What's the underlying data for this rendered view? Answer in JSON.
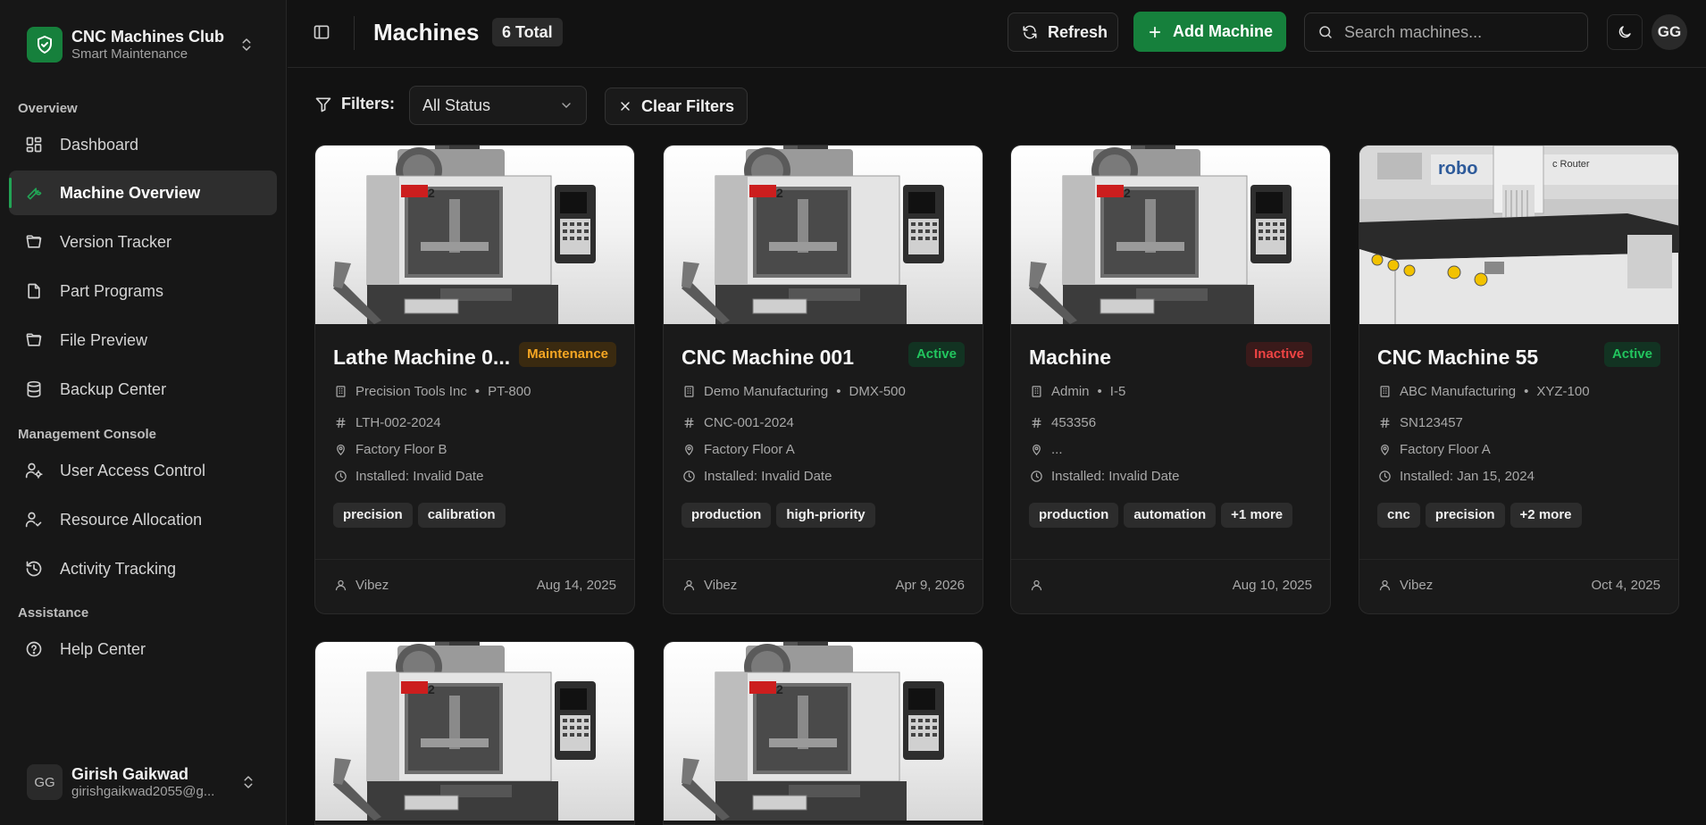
{
  "brand": {
    "title": "CNC Machines Club",
    "subtitle": "Smart Maintenance"
  },
  "sidebar": {
    "sections": {
      "overview": "Overview",
      "management": "Management Console",
      "assistance": "Assistance"
    },
    "items": [
      {
        "label": "Dashboard",
        "icon": "dashboard-icon"
      },
      {
        "label": "Machine Overview",
        "icon": "wrench-icon",
        "active": true
      },
      {
        "label": "Version Tracker",
        "icon": "folder-open-icon"
      },
      {
        "label": "Part Programs",
        "icon": "file-icon"
      },
      {
        "label": "File Preview",
        "icon": "folder-open-icon"
      },
      {
        "label": "Backup Center",
        "icon": "database-icon"
      },
      {
        "label": "User Access Control",
        "icon": "user-cog-icon"
      },
      {
        "label": "Resource Allocation",
        "icon": "user-check-icon"
      },
      {
        "label": "Activity Tracking",
        "icon": "history-icon"
      },
      {
        "label": "Help Center",
        "icon": "help-circle-icon"
      }
    ]
  },
  "user": {
    "initials": "GG",
    "name": "Girish Gaikwad",
    "email": "girishgaikwad2055@g..."
  },
  "header": {
    "title": "Machines",
    "total": "6 Total",
    "refresh_label": "Refresh",
    "add_label": "Add Machine",
    "search_placeholder": "Search machines...",
    "avatar_initials": "GG"
  },
  "filters": {
    "label": "Filters:",
    "status_value": "All Status",
    "clear_label": "Clear Filters"
  },
  "colors": {
    "accent_green": "#16803c",
    "status_active": "#22c55e",
    "status_inactive": "#ef4444",
    "status_maintenance": "#f5a623"
  },
  "machines": [
    {
      "title": "Lathe Machine 0...",
      "status": "Maintenance",
      "status_kind": "maint",
      "manufacturer": "Precision Tools Inc",
      "model": "PT-800",
      "serial": "LTH-002-2024",
      "location": "Factory Floor B",
      "installed": "Installed: Invalid Date",
      "tags": [
        "precision",
        "calibration"
      ],
      "owner": "Vibez",
      "date": "Aug 14, 2025",
      "image": "mill"
    },
    {
      "title": "CNC Machine 001",
      "status": "Active",
      "status_kind": "active",
      "manufacturer": "Demo Manufacturing",
      "model": "DMX-500",
      "serial": "CNC-001-2024",
      "location": "Factory Floor A",
      "installed": "Installed: Invalid Date",
      "tags": [
        "production",
        "high-priority"
      ],
      "owner": "Vibez",
      "date": "Apr 9, 2026",
      "image": "mill"
    },
    {
      "title": "Machine",
      "status": "Inactive",
      "status_kind": "inactive",
      "manufacturer": "Admin",
      "model": "I-5",
      "serial": "453356",
      "location": "...",
      "installed": "Installed: Invalid Date",
      "tags": [
        "production",
        "automation",
        "+1 more"
      ],
      "owner": "",
      "date": "Aug 10, 2025",
      "image": "mill"
    },
    {
      "title": "CNC Machine 55",
      "status": "Active",
      "status_kind": "active",
      "manufacturer": "ABC Manufacturing",
      "model": "XYZ-100",
      "serial": "SN123457",
      "location": "Factory Floor A",
      "installed": "Installed: Jan 15, 2024",
      "tags": [
        "cnc",
        "precision",
        "+2 more"
      ],
      "owner": "Vibez",
      "date": "Oct 4, 2025",
      "image": "router"
    }
  ],
  "router_image": {
    "brand_text": "robo",
    "label": "c Router"
  },
  "mill_image": {
    "badge": "2"
  }
}
